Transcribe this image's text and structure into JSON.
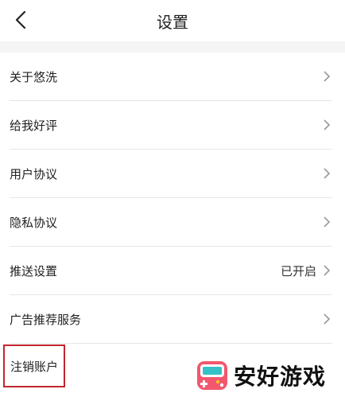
{
  "header": {
    "title": "设置"
  },
  "settings": {
    "items": [
      {
        "label": "关于悠洗"
      },
      {
        "label": "给我好评"
      },
      {
        "label": "用户协议"
      },
      {
        "label": "隐私协议"
      },
      {
        "label": "推送设置",
        "value": "已开启"
      },
      {
        "label": "广告推荐服务"
      },
      {
        "label": "注销账户"
      }
    ]
  },
  "watermark": {
    "text": "安好游戏",
    "logo_colors": {
      "pink": "#f2576e",
      "teal": "#36c1c8",
      "yellow": "#f5c22b"
    }
  },
  "colors": {
    "highlight": "#c2262e"
  }
}
